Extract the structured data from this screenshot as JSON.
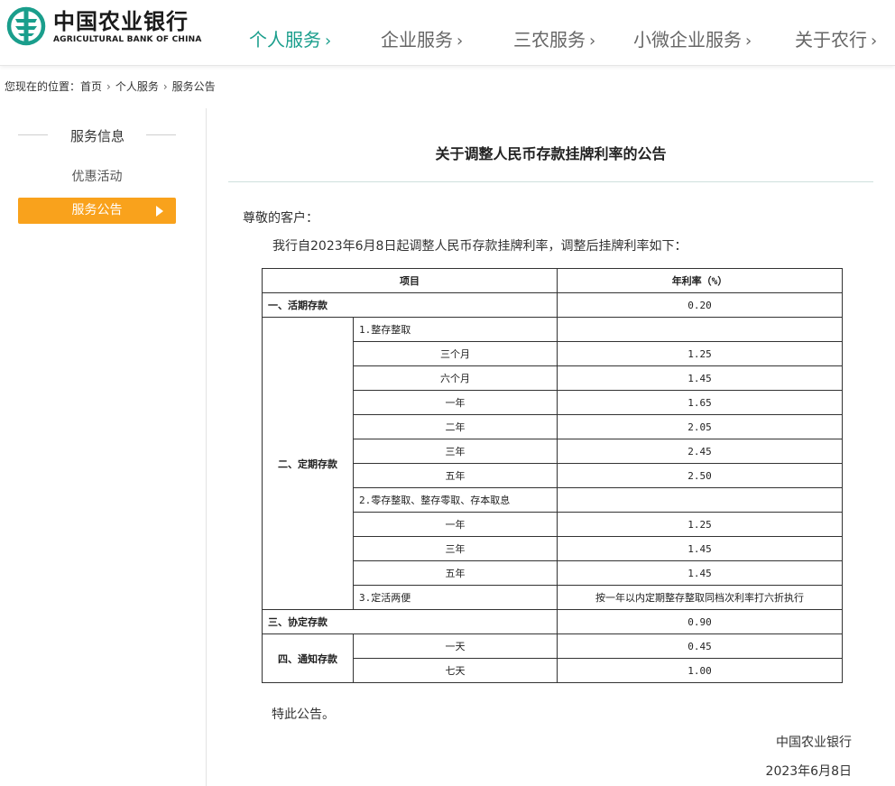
{
  "header": {
    "logo_cn": "中国农业银行",
    "logo_en": "AGRICULTURAL BANK OF CHINA",
    "nav": [
      {
        "label": "个人服务",
        "active": true
      },
      {
        "label": "企业服务",
        "active": false
      },
      {
        "label": "三农服务",
        "active": false
      },
      {
        "label": "小微企业服务",
        "active": false
      },
      {
        "label": "关于农行",
        "active": false
      }
    ],
    "chevron": "›"
  },
  "breadcrumb": {
    "prefix": "您现在的位置：",
    "items": [
      "首页",
      "个人服务",
      "服务公告"
    ],
    "separator": "›"
  },
  "sidebar": {
    "title": "服务信息",
    "items": [
      {
        "label": "优惠活动",
        "active": false
      },
      {
        "label": "服务公告",
        "active": true
      }
    ]
  },
  "article": {
    "title": "关于调整人民币存款挂牌利率的公告",
    "greeting": "尊敬的客户：",
    "intro": "我行自2023年6月8日起调整人民币存款挂牌利率，调整后挂牌利率如下：",
    "table": {
      "header": {
        "item": "项目",
        "rate": "年利率（%）"
      },
      "demand": {
        "label": "一、活期存款",
        "rate": "0.20"
      },
      "fixed": {
        "label": "二、定期存款",
        "lump_sum": {
          "label": "1.整存整取",
          "terms": [
            {
              "term": "三个月",
              "rate": "1.25"
            },
            {
              "term": "六个月",
              "rate": "1.45"
            },
            {
              "term": "一年",
              "rate": "1.65"
            },
            {
              "term": "二年",
              "rate": "2.05"
            },
            {
              "term": "三年",
              "rate": "2.45"
            },
            {
              "term": "五年",
              "rate": "2.50"
            }
          ]
        },
        "installment": {
          "label": "2.零存整取、整存零取、存本取息",
          "terms": [
            {
              "term": "一年",
              "rate": "1.25"
            },
            {
              "term": "三年",
              "rate": "1.45"
            },
            {
              "term": "五年",
              "rate": "1.45"
            }
          ]
        },
        "flexible": {
          "label": "3.定活两便",
          "rate": "按一年以内定期整存整取同档次利率打六折执行"
        }
      },
      "agreement": {
        "label": "三、协定存款",
        "rate": "0.90"
      },
      "notice": {
        "label": "四、通知存款",
        "terms": [
          {
            "term": "一天",
            "rate": "0.45"
          },
          {
            "term": "七天",
            "rate": "1.00"
          }
        ]
      }
    },
    "closing": "特此公告。",
    "signature_bank": "中国农业银行",
    "signature_date": "2023年6月8日"
  },
  "colors": {
    "brand_green": "#1a9e8c",
    "sidebar_active": "#f9a21c"
  },
  "icons": {
    "logo": "abc-logo-icon",
    "sidebar_active_arrow": "triangle-right-icon"
  }
}
